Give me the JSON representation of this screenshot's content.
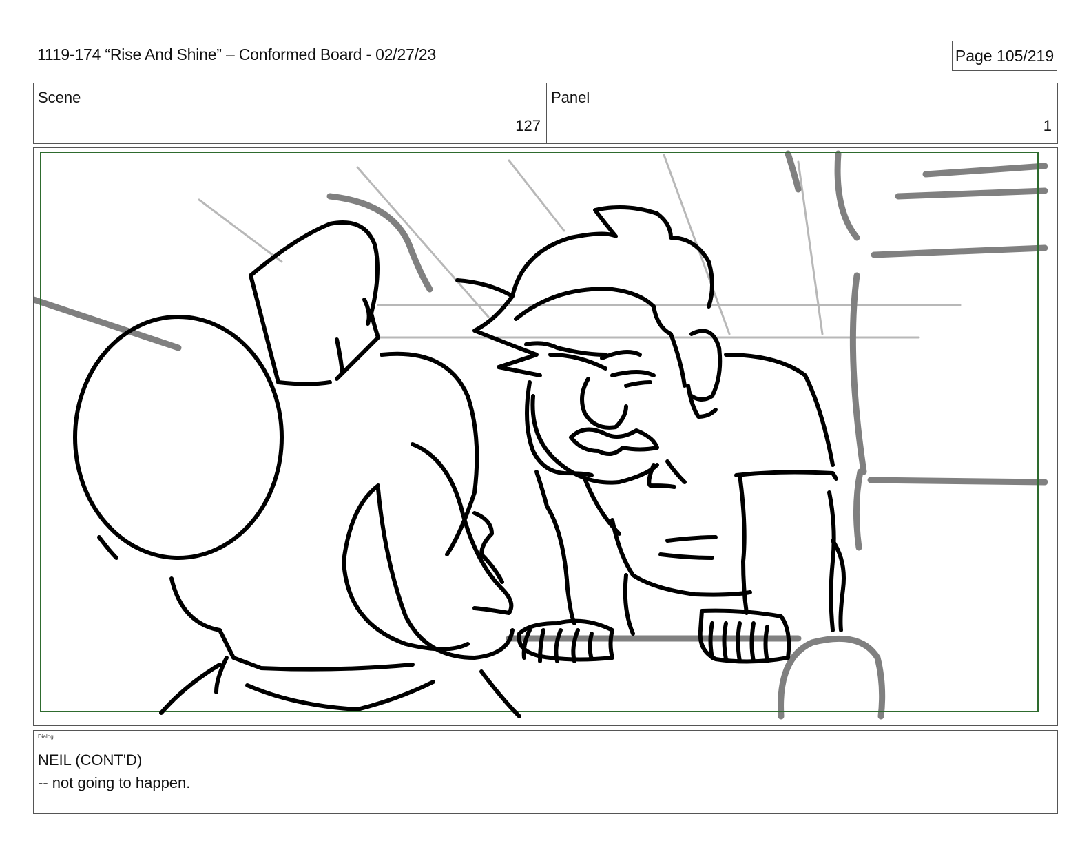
{
  "header": {
    "title": "1119-174 “Rise And Shine” – Conformed Board - 02/27/23",
    "page": "Page 105/219"
  },
  "info": {
    "scene_label": "Scene",
    "scene_value": "127",
    "panel_label": "Panel",
    "panel_value": "1"
  },
  "colors": {
    "safe_frame": "#2e6b2e",
    "ink": "#000000",
    "shading": "#808080"
  },
  "dialog": {
    "tag": "Dialog",
    "character": "NEIL (CONT'D)",
    "line": "-- not going to happen."
  }
}
